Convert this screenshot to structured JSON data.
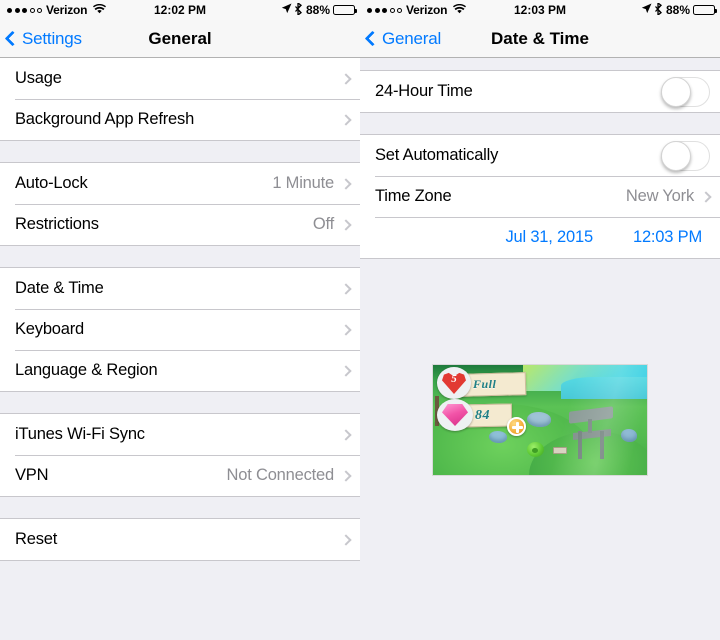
{
  "left": {
    "status": {
      "signal_filled": 3,
      "signal_empty": 2,
      "carrier": "Verizon",
      "wifi_icon": "wifi-icon",
      "time": "12:02 PM",
      "location_icon": "location-arrow-icon",
      "bluetooth_icon": "bluetooth-icon",
      "battery_percent": "88%",
      "battery_level": 88
    },
    "nav": {
      "back_label": "Settings",
      "title": "General"
    },
    "groups": [
      {
        "rows": [
          {
            "label": "Usage",
            "value": "",
            "accessory": "chevron"
          },
          {
            "label": "Background App Refresh",
            "value": "",
            "accessory": "chevron"
          }
        ]
      },
      {
        "rows": [
          {
            "label": "Auto-Lock",
            "value": "1 Minute",
            "accessory": "chevron"
          },
          {
            "label": "Restrictions",
            "value": "Off",
            "accessory": "chevron"
          }
        ]
      },
      {
        "rows": [
          {
            "label": "Date & Time",
            "value": "",
            "accessory": "chevron"
          },
          {
            "label": "Keyboard",
            "value": "",
            "accessory": "chevron"
          },
          {
            "label": "Language & Region",
            "value": "",
            "accessory": "chevron"
          }
        ]
      },
      {
        "rows": [
          {
            "label": "iTunes Wi-Fi Sync",
            "value": "",
            "accessory": "chevron"
          },
          {
            "label": "VPN",
            "value": "Not Connected",
            "accessory": "chevron"
          }
        ]
      },
      {
        "rows": [
          {
            "label": "Reset",
            "value": "",
            "accessory": "chevron"
          }
        ]
      }
    ]
  },
  "right": {
    "status": {
      "signal_filled": 3,
      "signal_empty": 2,
      "carrier": "Verizon",
      "wifi_icon": "wifi-icon",
      "time": "12:03 PM",
      "location_icon": "location-arrow-icon",
      "bluetooth_icon": "bluetooth-icon",
      "battery_percent": "88%",
      "battery_level": 88
    },
    "nav": {
      "back_label": "General",
      "title": "Date & Time"
    },
    "rows": {
      "hour24_label": "24-Hour Time",
      "hour24_on": false,
      "set_auto_label": "Set Automatically",
      "set_auto_on": false,
      "timezone_label": "Time Zone",
      "timezone_value": "New York",
      "date_value": "Jul 31, 2015",
      "time_value": "12:03 PM"
    },
    "thumbnail": {
      "name": "game-screenshot",
      "lives_count": "5",
      "lives_status": "Full",
      "gems_count": "84",
      "plus_icon": "plus-icon"
    }
  },
  "colors": {
    "tint_blue": "#027aff",
    "value_gray": "#8e8e93",
    "table_bg": "#efeff4",
    "separator": "#c8c7cc",
    "toggle_on": "#4cd964"
  }
}
